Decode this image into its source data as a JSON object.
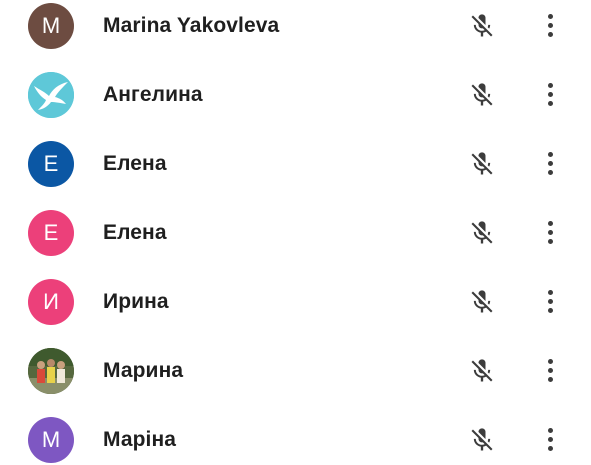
{
  "participants": [
    {
      "name": "Marina Yakovleva",
      "initial": "M",
      "avatar_color": "#6d4c41",
      "avatar_type": "letter",
      "mic": "muted"
    },
    {
      "name": "Ангелина",
      "initial": "",
      "avatar_color": "#5ec8d8",
      "avatar_type": "bird-photo",
      "mic": "muted"
    },
    {
      "name": "Елена",
      "initial": "E",
      "avatar_color": "#0b57a4",
      "avatar_type": "letter",
      "mic": "muted"
    },
    {
      "name": "Елена",
      "initial": "E",
      "avatar_color": "#ec407a",
      "avatar_type": "letter",
      "mic": "muted"
    },
    {
      "name": "Ирина",
      "initial": "И",
      "avatar_color": "#ec407a",
      "avatar_type": "letter",
      "mic": "muted"
    },
    {
      "name": "Марина",
      "initial": "",
      "avatar_color": "#4b5e3a",
      "avatar_type": "group-photo",
      "mic": "muted"
    },
    {
      "name": "Маріна",
      "initial": "M",
      "avatar_color": "#7e57c2",
      "avatar_type": "letter",
      "mic": "muted"
    }
  ],
  "icons": {
    "mic": "mic-off-icon",
    "more": "more-vert-icon"
  }
}
